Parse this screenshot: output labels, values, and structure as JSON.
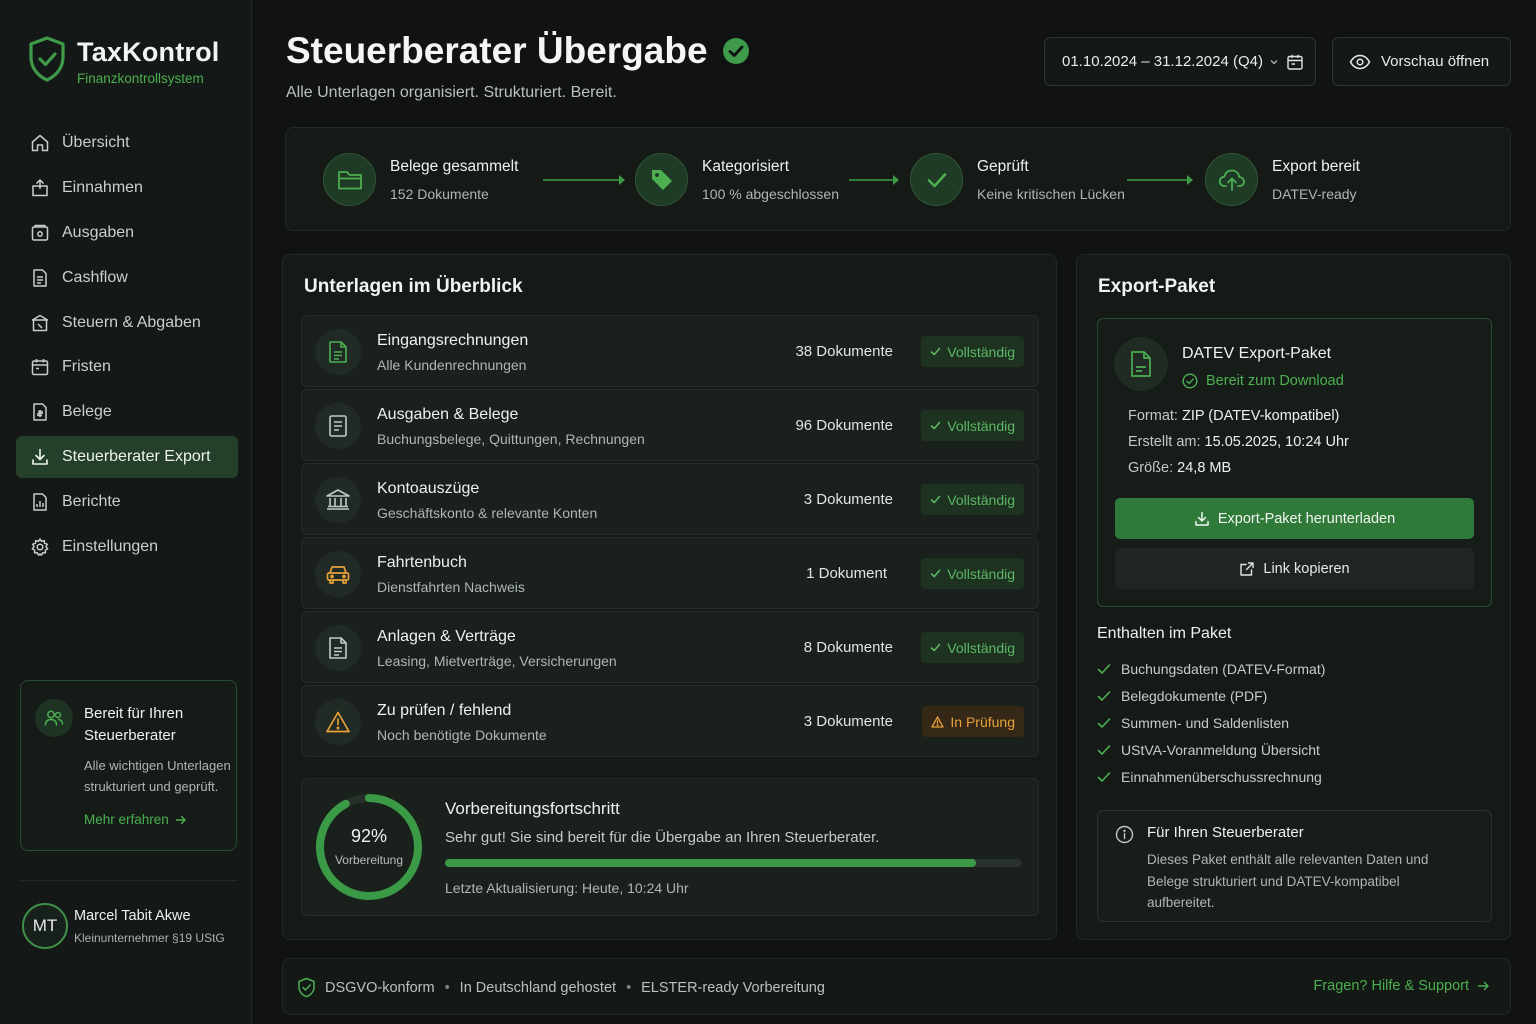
{
  "app": {
    "name": "TaxKontrol",
    "tagline": "Finanzkontrollsystem"
  },
  "colors": {
    "accent": "#4caf50",
    "accent_dark": "#2f7a38",
    "warning": "#e6a13a",
    "background": "#101312"
  },
  "sidebar": {
    "items": [
      {
        "label": "Übersicht",
        "icon": "home-icon"
      },
      {
        "label": "Einnahmen",
        "icon": "income-icon"
      },
      {
        "label": "Ausgaben",
        "icon": "wallet-icon"
      },
      {
        "label": "Cashflow",
        "icon": "document-icon"
      },
      {
        "label": "Steuern & Abgaben",
        "icon": "tax-building-icon"
      },
      {
        "label": "Fristen",
        "icon": "calendar-icon"
      },
      {
        "label": "Belege",
        "icon": "receipt-icon"
      },
      {
        "label": "Steuerberater Export",
        "icon": "download-icon",
        "active": true
      },
      {
        "label": "Berichte",
        "icon": "report-icon"
      },
      {
        "label": "Einstellungen",
        "icon": "gear-icon"
      }
    ],
    "ready_card": {
      "title": "Bereit für Ihren Steuerberater",
      "text": "Alle wichtigen Unterlagen strukturiert und geprüft.",
      "link": "Mehr erfahren"
    },
    "user": {
      "initials": "MT",
      "name": "Marcel Tabit Akwe",
      "role": "Kleinunternehmer §19 UStG"
    }
  },
  "header": {
    "title": "Steuerberater Übergabe",
    "subtitle": "Alle Unterlagen organisiert. Strukturiert. Bereit.",
    "date_range": "01.10.2024 – 31.12.2024 (Q4)",
    "preview_button": "Vorschau öffnen"
  },
  "steps": [
    {
      "title": "Belege gesammelt",
      "sub": "152 Dokumente",
      "icon": "folder-icon"
    },
    {
      "title": "Kategorisiert",
      "sub": "100 % abgeschlossen",
      "icon": "tag-icon"
    },
    {
      "title": "Geprüft",
      "sub": "Keine kritischen Lücken",
      "icon": "check-icon"
    },
    {
      "title": "Export bereit",
      "sub": "DATEV-ready",
      "icon": "cloud-upload-icon"
    }
  ],
  "documents": {
    "title": "Unterlagen im Überblick",
    "rows": [
      {
        "name": "Eingangsrechnungen",
        "desc": "Alle Kundenrechnungen",
        "count": "38 Dokumente",
        "status": "Vollständig",
        "state": "ok",
        "icon": "invoice-icon"
      },
      {
        "name": "Ausgaben & Belege",
        "desc": "Buchungsbelege, Quittungen, Rechnungen",
        "count": "96 Dokumente",
        "status": "Vollständig",
        "state": "ok",
        "icon": "receipt-icon"
      },
      {
        "name": "Kontoauszüge",
        "desc": "Geschäftskonto & relevante Konten",
        "count": "3 Dokumente",
        "status": "Vollständig",
        "state": "ok",
        "icon": "bank-icon"
      },
      {
        "name": "Fahrtenbuch",
        "desc": "Dienstfahrten Nachweis",
        "count": "1 Dokument",
        "status": "Vollständig",
        "state": "ok",
        "icon": "car-icon"
      },
      {
        "name": "Anlagen & Verträge",
        "desc": "Leasing, Mietverträge, Versicherungen",
        "count": "8 Dokumente",
        "status": "Vollständig",
        "state": "ok",
        "icon": "contract-icon"
      },
      {
        "name": "Zu prüfen / fehlend",
        "desc": "Noch benötigte Dokumente",
        "count": "3 Dokumente",
        "status": "In Prüfung",
        "state": "warn",
        "icon": "warning-icon"
      }
    ],
    "progress": {
      "percent_label": "92%",
      "percent": 92,
      "ring_label": "Vorbereitung",
      "title": "Vorbereitungsfortschritt",
      "text": "Sehr gut! Sie sind bereit für die Übergabe an Ihren Steuerberater.",
      "updated": "Letzte Aktualisierung: Heute, 10:24 Uhr"
    }
  },
  "export": {
    "title": "Export-Paket",
    "package": {
      "title": "DATEV Export-Paket",
      "status": "Bereit zum Download",
      "format_label": "Format:",
      "format": "ZIP (DATEV-kompatibel)",
      "created_label": "Erstellt am:",
      "created": "15.05.2025, 10:24 Uhr",
      "size_label": "Größe:",
      "size": "24,8 MB",
      "download_button": "Export-Paket herunterladen",
      "copy_button": "Link kopieren"
    },
    "included_title": "Enthalten im Paket",
    "included": [
      "Buchungsdaten (DATEV-Format)",
      "Belegdokumente (PDF)",
      "Summen- und Saldenlisten",
      "UStVA-Voranmeldung Übersicht",
      "Einnahmenüberschussrechnung"
    ],
    "info": {
      "title": "Für Ihren Steuerberater",
      "text": "Dieses Paket enthält alle relevanten Daten und Belege strukturiert und DATEV-kompatibel aufbereitet."
    }
  },
  "footer": {
    "items": [
      "DSGVO-konform",
      "In Deutschland gehostet",
      "ELSTER-ready Vorbereitung"
    ],
    "help": "Fragen? Hilfe & Support"
  }
}
